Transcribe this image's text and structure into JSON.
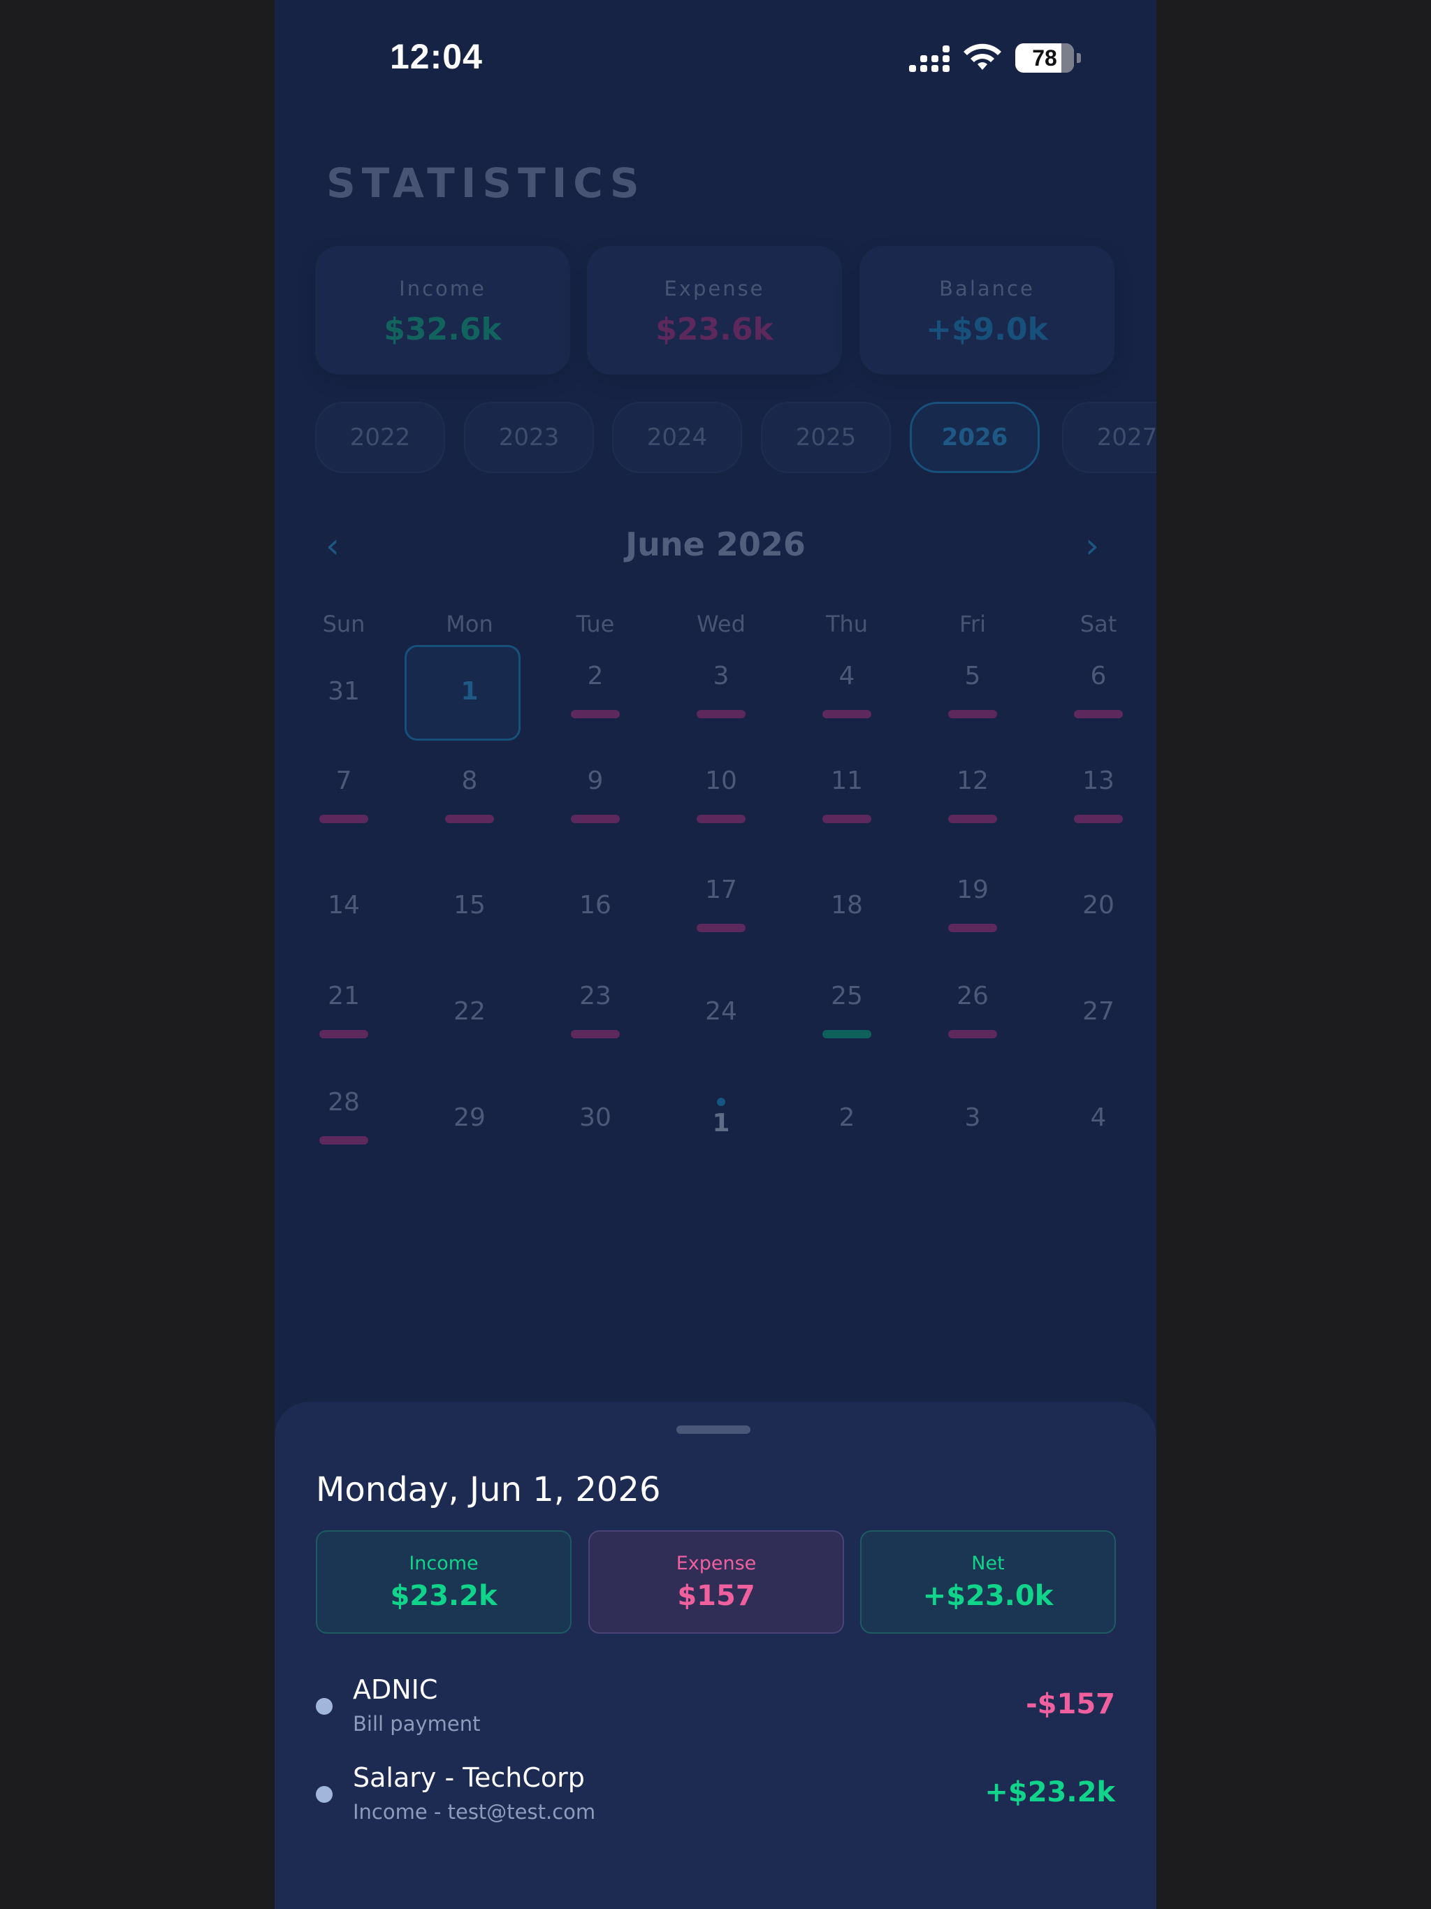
{
  "status_bar": {
    "time": "12:04",
    "battery": "78"
  },
  "header": {
    "title": "STATISTICS"
  },
  "summary": [
    {
      "label": "Income",
      "value": "$32.6k",
      "color": "#10b981"
    },
    {
      "label": "Expense",
      "value": "$23.6k",
      "color": "#c0327f"
    },
    {
      "label": "Balance",
      "value": "+$9.0k",
      "color": "#1b8fc5"
    }
  ],
  "years": [
    "2022",
    "2023",
    "2024",
    "2025",
    "2026",
    "2027"
  ],
  "selected_year": "2026",
  "calendar": {
    "month_title": "June 2026",
    "prev_icon": "‹",
    "next_icon": "›",
    "weekdays": [
      "Sun",
      "Mon",
      "Tue",
      "Wed",
      "Thu",
      "Fri",
      "Sat"
    ],
    "weeks": [
      [
        "31",
        "1",
        "2",
        "3",
        "4",
        "5",
        "6"
      ],
      [
        "7",
        "8",
        "9",
        "10",
        "11",
        "12",
        "13"
      ],
      [
        "14",
        "15",
        "16",
        "17",
        "18",
        "19",
        "20"
      ],
      [
        "21",
        "22",
        "23",
        "24",
        "25",
        "26",
        "27"
      ],
      [
        "28",
        "29",
        "30",
        "1",
        "2",
        "3",
        "4"
      ]
    ]
  },
  "sheet": {
    "date": "Monday, Jun 1, 2026",
    "cards": [
      {
        "label": "Income",
        "value": "$23.2k",
        "color": "#10d48a"
      },
      {
        "label": "Expense",
        "value": "$157",
        "color": "#f0609e"
      },
      {
        "label": "Net",
        "value": "+$23.0k",
        "color": "#10d48a"
      }
    ],
    "transactions": [
      {
        "title": "ADNIC",
        "subtitle": "Bill payment",
        "amount": "-$157",
        "color": "#f0609e"
      },
      {
        "title": "Salary - TechCorp",
        "subtitle": "Income - test@test.com",
        "amount": "+$23.2k",
        "color": "#10d48a"
      }
    ]
  }
}
